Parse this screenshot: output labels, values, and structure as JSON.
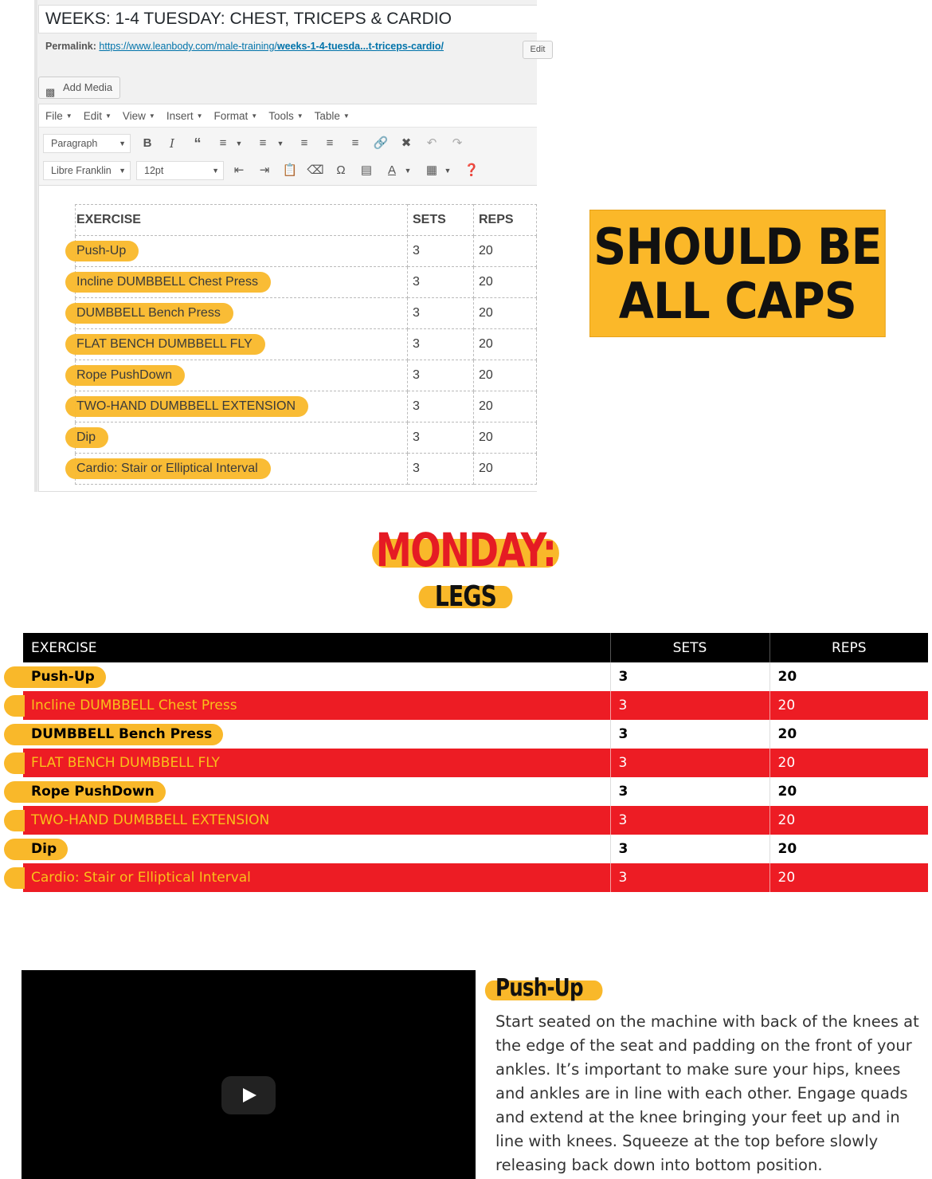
{
  "editor": {
    "title": "WEEKS: 1-4 TUESDAY: CHEST, TRICEPS & CARDIO",
    "permalink_label": "Permalink:",
    "permalink_url_prefix": "https://www.leanbody.com/male-training/",
    "permalink_url_slug": "weeks-1-4-tuesda...t-triceps-cardio/",
    "edit_button": "Edit",
    "add_media": "Add Media",
    "menu": [
      "File",
      "Edit",
      "View",
      "Insert",
      "Format",
      "Tools",
      "Table"
    ],
    "format_select": "Paragraph",
    "font_select": "Libre Franklin",
    "size_select": "12pt",
    "table": {
      "headers": [
        "EXERCISE",
        "SETS",
        "REPS"
      ],
      "rows": [
        [
          "Push-Up",
          "3",
          "20"
        ],
        [
          "Incline DUMBBELL Chest Press",
          "3",
          "20"
        ],
        [
          "DUMBBELL Bench Press",
          "3",
          "20"
        ],
        [
          "FLAT BENCH DUMBBELL FLY",
          "3",
          "20"
        ],
        [
          "Rope PushDown",
          "3",
          "20"
        ],
        [
          "TWO-HAND DUMBBELL EXTENSION",
          "3",
          "20"
        ],
        [
          "Dip",
          "3",
          "20"
        ],
        [
          "Cardio: Stair or Elliptical Interval",
          "3",
          "20"
        ]
      ]
    }
  },
  "callout": {
    "line1": "SHOULD BE",
    "line2": "ALL CAPS",
    "color": "#fbb829"
  },
  "site": {
    "day_title": "MONDAY:",
    "sub_title": "LEGS",
    "accent_red": "#ed1c24",
    "accent_yellow": "#f9b82a",
    "table": {
      "headers": [
        "EXERCISE",
        "SETS",
        "REPS"
      ],
      "rows": [
        [
          "Push-Up",
          "3",
          "20"
        ],
        [
          "Incline DUMBBELL Chest Press",
          "3",
          "20"
        ],
        [
          "DUMBBELL Bench Press",
          "3",
          "20"
        ],
        [
          "FLAT BENCH DUMBBELL FLY",
          "3",
          "20"
        ],
        [
          "Rope PushDown",
          "3",
          "20"
        ],
        [
          "TWO-HAND DUMBBELL EXTENSION",
          "3",
          "20"
        ],
        [
          "Dip",
          "3",
          "20"
        ],
        [
          "Cardio: Stair or Elliptical Interval",
          "3",
          "20"
        ]
      ]
    },
    "exercise": {
      "title": "Push-Up",
      "description": "Start seated on the machine with back of the knees at the edge of the seat and padding on the front of your ankles. It’s important to make sure your hips, knees and ankles are in line with each other. Engage quads and extend at the knee bringing your feet up and in line with knees. Squeeze at the top before slowly releasing back down into bottom position."
    }
  }
}
